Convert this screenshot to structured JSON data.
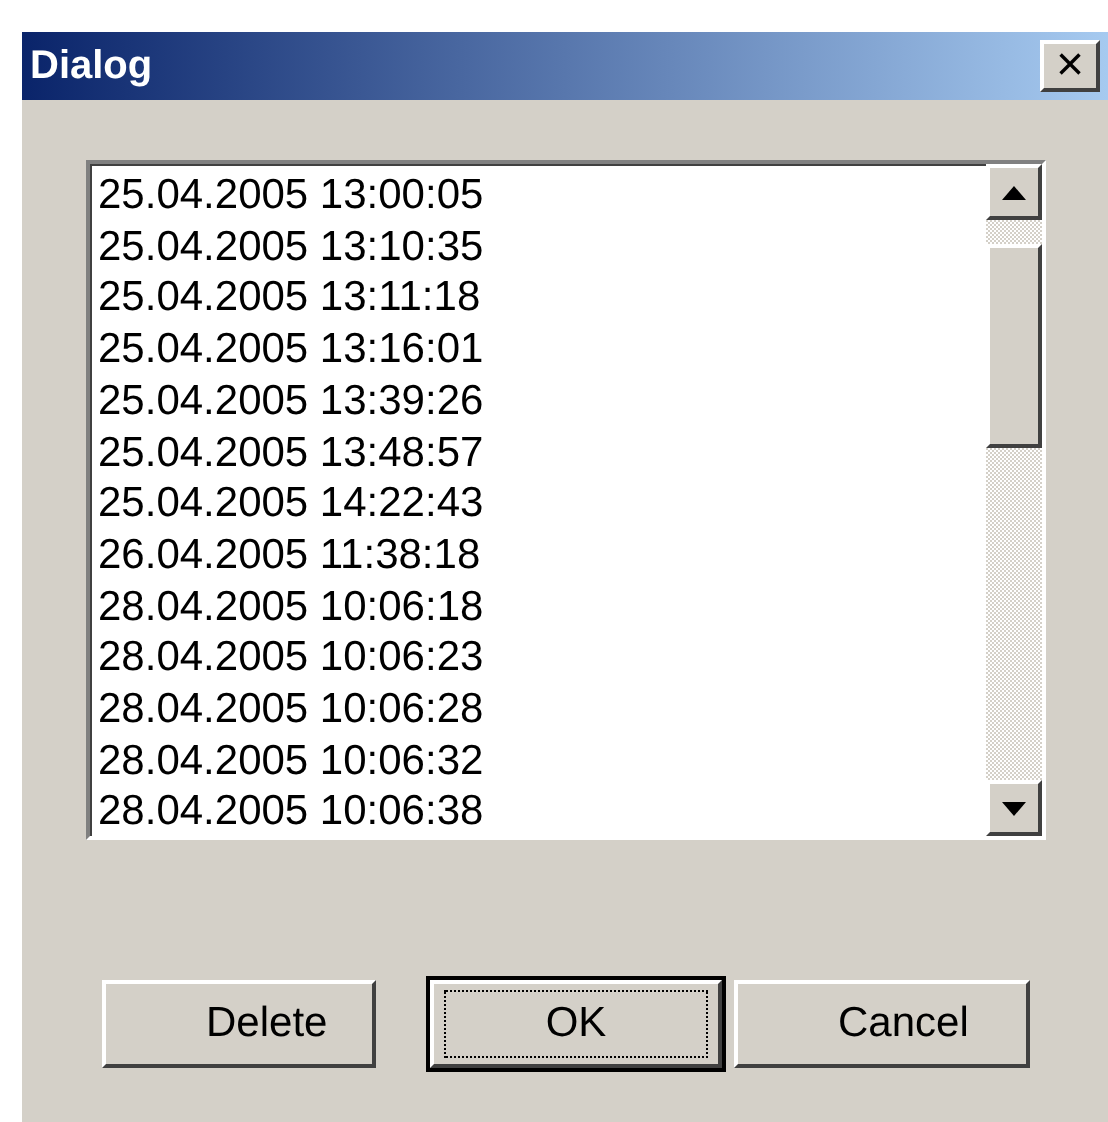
{
  "window": {
    "title": "Dialog",
    "close_button": "×"
  },
  "list": {
    "items": [
      "25.04.2005 13:00:05",
      "25.04.2005 13:10:35",
      "25.04.2005 13:11:18",
      "25.04.2005 13:16:01",
      "25.04.2005 13:39:26",
      "25.04.2005 13:48:57",
      "25.04.2005 14:22:43",
      "26.04.2005 11:38:18",
      "28.04.2005 10:06:18",
      "28.04.2005 10:06:23",
      "28.04.2005 10:06:28",
      "28.04.2005 10:06:32",
      "28.04.2005 10:06:38"
    ]
  },
  "buttons": [
    {
      "label": "Delete",
      "focused": false
    },
    {
      "label": "OK",
      "focused": true
    },
    {
      "label": "Cancel",
      "focused": false
    }
  ]
}
